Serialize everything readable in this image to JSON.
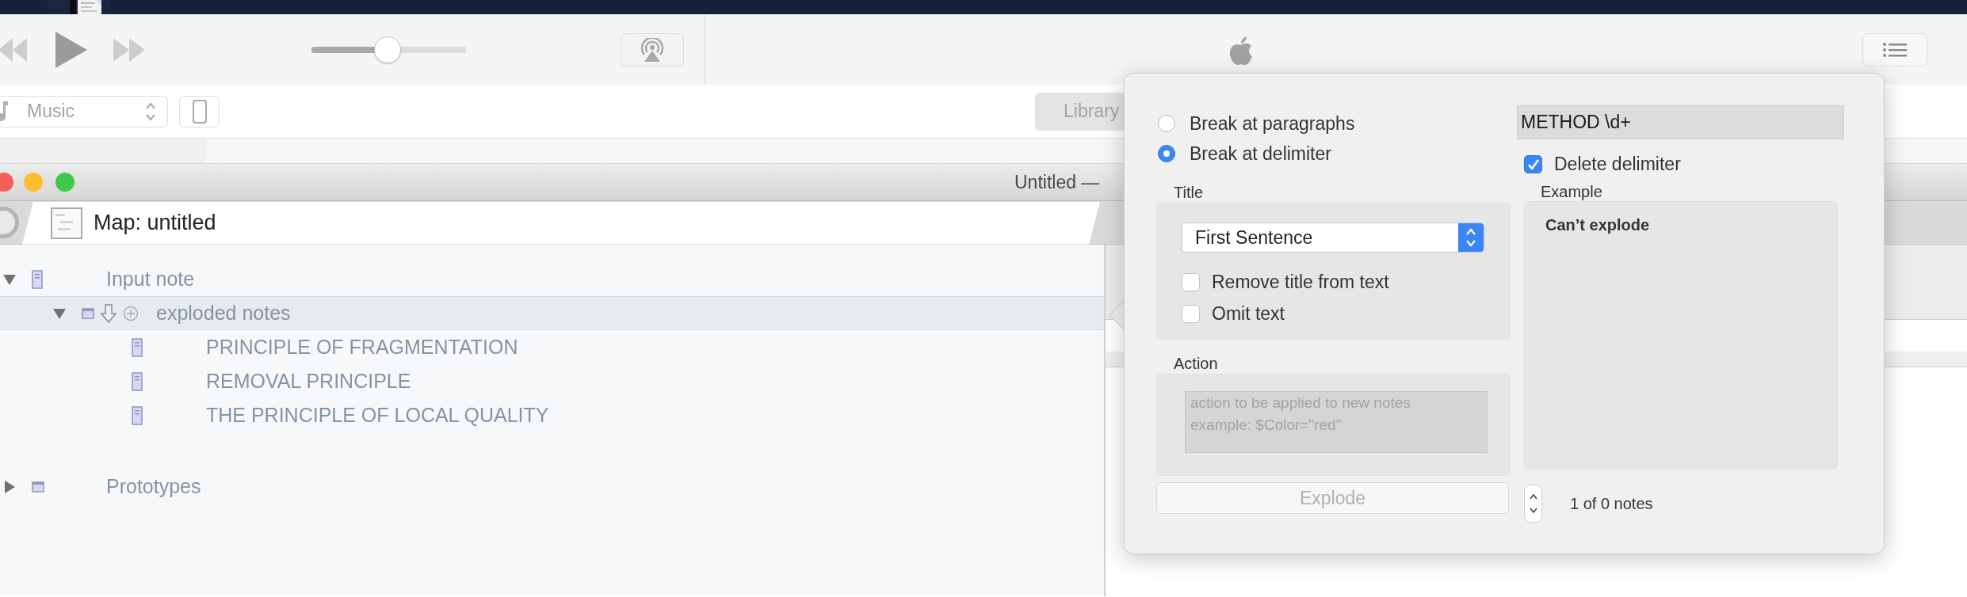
{
  "player": {
    "volume": {
      "level": 0.49
    }
  },
  "source_menu": {
    "label": "Music"
  },
  "library_button": {
    "label": "Library"
  },
  "window": {
    "title": "Untitled —"
  },
  "tabs": [
    {
      "label": "Map: untitled",
      "selected": true
    }
  ],
  "outline": [
    {
      "label": "Input note",
      "kind": "note",
      "expanded": true,
      "selected": false,
      "children": [
        {
          "label": "exploded notes",
          "kind": "container",
          "expanded": true,
          "selected": true,
          "children": [
            {
              "label": "PRINCIPLE OF FRAGMENTATION",
              "kind": "note",
              "selected": false
            },
            {
              "label": "REMOVAL PRINCIPLE",
              "kind": "note",
              "selected": false
            },
            {
              "label": "THE PRINCIPLE OF LOCAL QUALITY",
              "kind": "note",
              "selected": false
            }
          ]
        }
      ]
    },
    {
      "label": "Prototypes",
      "kind": "container",
      "expanded": false,
      "selected": false
    }
  ],
  "explode_popover": {
    "break_mode": [
      {
        "label": "Break at paragraphs",
        "selected": false
      },
      {
        "label": "Break at delimiter",
        "selected": true
      }
    ],
    "title_section": {
      "heading": "Title",
      "method": "First Sentence",
      "options": [
        {
          "label": "Remove title from text",
          "checked": false
        },
        {
          "label": "Omit text",
          "checked": false
        }
      ]
    },
    "action_section": {
      "heading": "Action",
      "placeholder": "action to be applied to new notes\nexample: $Color=\"red\""
    },
    "explode_button": {
      "label": "Explode",
      "disabled": true
    },
    "delimiter": {
      "value": "METHOD \\d+"
    },
    "delete_delimiter": {
      "label": "Delete delimiter",
      "checked": true
    },
    "example": {
      "heading": "Example",
      "text": "Can’t explode"
    },
    "count": "1 of 0 notes"
  }
}
